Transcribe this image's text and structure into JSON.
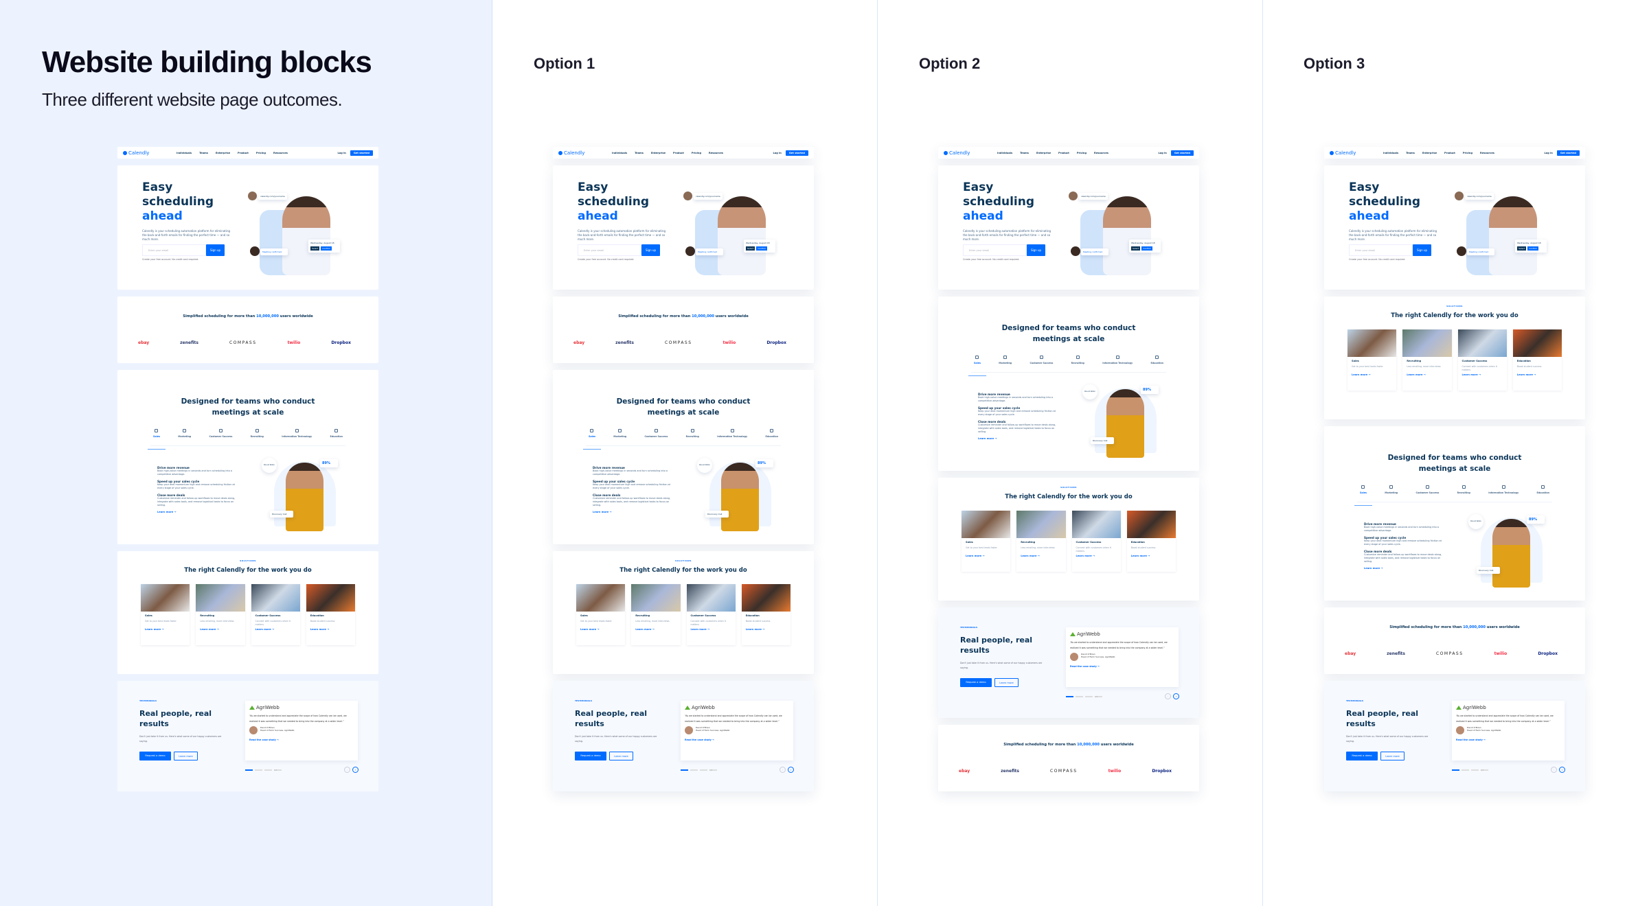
{
  "intro": {
    "title": "Website building blocks",
    "subtitle": "Three different website page outcomes."
  },
  "options": [
    {
      "label": "Option 1",
      "order": [
        "hero",
        "logos",
        "designed",
        "solutions",
        "testimonials"
      ]
    },
    {
      "label": "Option 2",
      "order": [
        "hero",
        "designed",
        "solutions",
        "testimonials",
        "logos"
      ]
    },
    {
      "label": "Option 3",
      "order": [
        "hero",
        "solutions",
        "designed",
        "logos",
        "testimonials"
      ]
    }
  ],
  "original_order": [
    "hero",
    "logos",
    "designed",
    "solutions",
    "testimonials"
  ],
  "mockup": {
    "nav": {
      "brand": "Calendly",
      "links": [
        "Individuals",
        "Teams",
        "Enterprise",
        "Product",
        "Pricing",
        "Resources"
      ],
      "login": "Log in",
      "cta": "Get started"
    },
    "hero": {
      "line1": "Easy",
      "line2": "scheduling",
      "line3": "ahead",
      "paragraph": "Calendly is your scheduling automation platform for eliminating the back-and-forth emails for finding the perfect time — and so much more.",
      "email_placeholder": "Enter your email",
      "signup": "Sign up",
      "note": "Create your free account. No credit card required.",
      "card_link": "calendly.com/yourname",
      "card_date": "Wednesday, August 18",
      "card_btn1": "Select",
      "card_btn2": "Confirm",
      "card_confirmed": "Meeting confirmed"
    },
    "logos": {
      "text_pre": "Simplified scheduling for more than",
      "number": "10,000,000",
      "text_post": "users worldwide",
      "brands": [
        "ebay",
        "zenefits",
        "COMPASS",
        "twilio",
        "Dropbox"
      ]
    },
    "designed": {
      "title": "Designed for teams who conduct meetings at scale",
      "tabs": [
        "Sales",
        "Marketing",
        "Customer Success",
        "Recruiting",
        "Information Technology",
        "Education"
      ],
      "active_tab": "Sales",
      "features": [
        {
          "title": "Drive more revenue",
          "desc": "Book high-value meetings in seconds and turn scheduling into a competitive advantage."
        },
        {
          "title": "Speed up your sales cycle",
          "desc": "Keep your deal momentum high and remove scheduling friction at every stage of your sales cycle."
        },
        {
          "title": "Close more deals",
          "desc": "Customize reminder and follow-up workflows to move deals along, integrate with sales tools, and remove logistical tasks to focus on selling."
        }
      ],
      "learn_more": "Learn more →",
      "stat": "89%",
      "badge": "Round Robin",
      "card_title": "Discovery Call"
    },
    "solutions": {
      "eyebrow": "SOLUTIONS",
      "title": "The right Calendly for the work you do",
      "cards": [
        {
          "title": "Sales",
          "desc": "Get to your best leads faster",
          "link": "Learn more →"
        },
        {
          "title": "Recruiting",
          "desc": "Less emailing, more interviews",
          "link": "Learn more →"
        },
        {
          "title": "Customer Success",
          "desc": "Connect with customers when it matters",
          "link": "Learn more →"
        },
        {
          "title": "Education",
          "desc": "Boost student success",
          "link": "Learn more →"
        }
      ]
    },
    "testimonials": {
      "eyebrow": "TESTIMONIALS",
      "title": "Real people, real results",
      "desc": "Don't just take it from us. Here's what some of our happy customers are saying.",
      "demo": "Request a demo",
      "learn": "Learn more",
      "company": "AgriWebb",
      "quote": "“As we started to understand and appreciate the scope of how Calendly can be used, we realized it was something that we needed to bring into the company at a wider level.”",
      "author": "David O'Brien",
      "role": "Head of Farm Success, AgriWebb",
      "case": "Read the case study →",
      "pager": "1/3"
    }
  },
  "colors": {
    "accent": "#006bff",
    "heading": "#0b3558",
    "intro_bg": "#edf3fe"
  }
}
